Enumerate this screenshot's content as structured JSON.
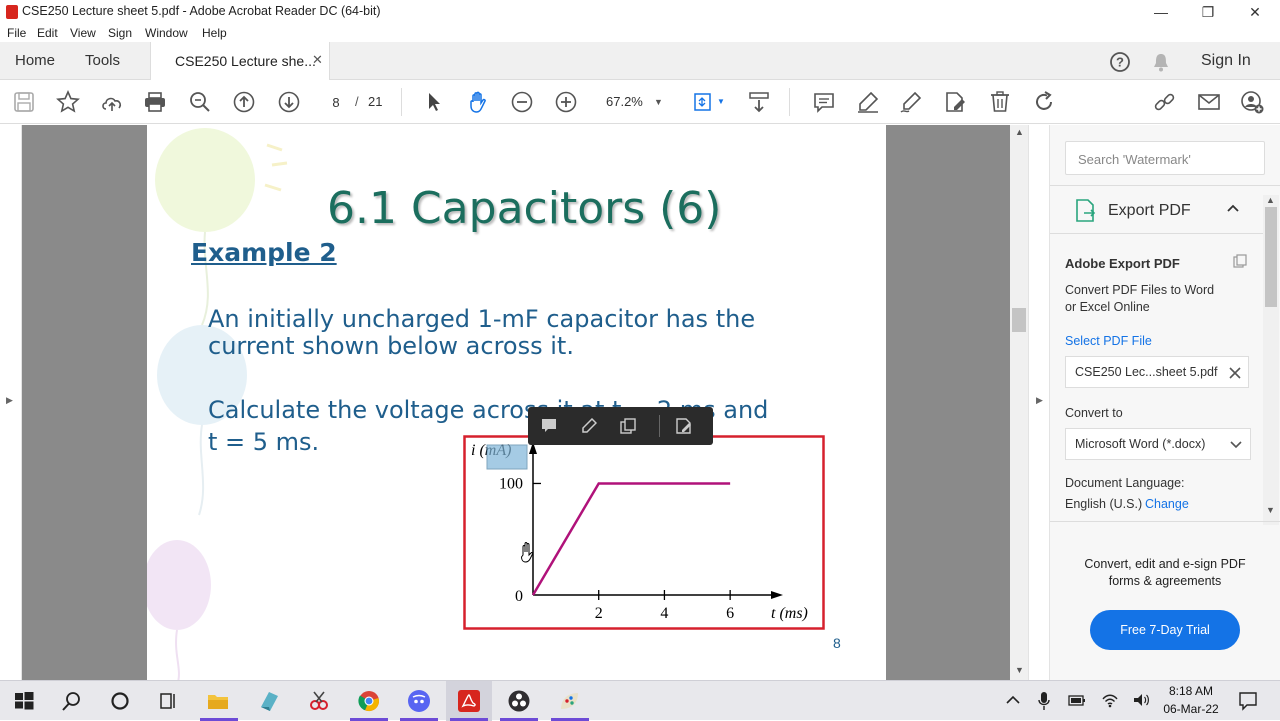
{
  "window": {
    "title": "CSE250 Lecture sheet 5.pdf - Adobe Acrobat Reader DC (64-bit)",
    "minimize_glyph": "—",
    "restore_glyph": "❐",
    "close_glyph": "✕"
  },
  "menu": [
    "File",
    "Edit",
    "View",
    "Sign",
    "Window",
    "Help"
  ],
  "tabs": {
    "home": "Home",
    "tools": "Tools",
    "doc": "CSE250 Lecture she...",
    "sign_in": "Sign In"
  },
  "toolbar": {
    "page_current": "8",
    "page_sep": "/",
    "page_total": "21",
    "zoom": "67.2%"
  },
  "slide": {
    "title": "6.1 Capacitors (6)",
    "example": "Example 2",
    "para1_line1": "An initially uncharged 1-mF capacitor has the",
    "para1_line2": "current shown below across it.",
    "para2_line1": "Calculate the voltage across it at t = 2 ms and",
    "para2_line2": "t = 5 ms.",
    "page_number": "8",
    "title_color": "#1b6e5e",
    "text_color": "#1f5e8c"
  },
  "chart_data": {
    "type": "line",
    "xlabel": "t (ms)",
    "ylabel": "i (mA)",
    "x_ticks": [
      "2",
      "4",
      "6"
    ],
    "y_ticks": [
      "0",
      "100"
    ],
    "series": [
      {
        "x": [
          0,
          2,
          6
        ],
        "y": [
          0,
          100,
          100
        ],
        "color": "#b0127a"
      }
    ],
    "xlim": [
      0,
      7
    ],
    "ylim": [
      0,
      130
    ],
    "frame_color": "#d6202d"
  },
  "right_pane": {
    "search_placeholder": "Search 'Watermark'",
    "export_title": "Export PDF",
    "adobe_export": "Adobe Export PDF",
    "desc_line1": "Convert PDF Files to Word",
    "desc_line2": "or Excel Online",
    "select_file": "Select PDF File",
    "file_name": "CSE250 Lec...sheet 5.pdf",
    "convert_to": "Convert to",
    "format": "Microsoft Word (*.docx)",
    "doc_lang": "Document Language:",
    "lang": "English (U.S.)",
    "change": "Change",
    "promo_line1": "Convert, edit and e-sign PDF",
    "promo_line2": "forms & agreements",
    "trial": "Free 7-Day Trial",
    "accent": "#1473e6"
  },
  "taskbar": {
    "time": "8:18 AM",
    "date": "06-Mar-22"
  }
}
